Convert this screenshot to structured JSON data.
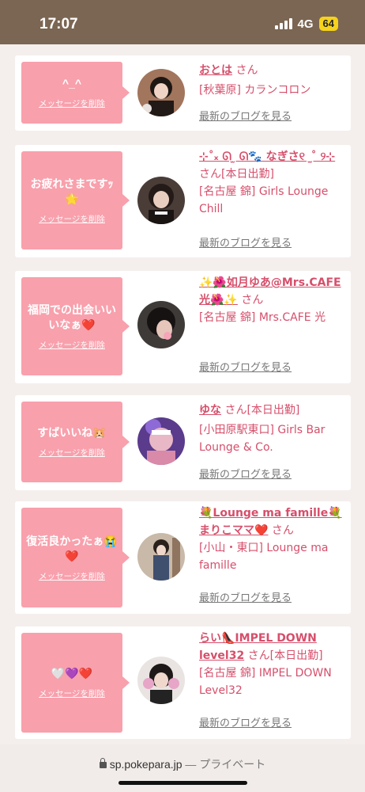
{
  "status_bar": {
    "time": "17:07",
    "network": "4G",
    "battery": "64"
  },
  "messages": [
    {
      "message": "^_^",
      "delete_label": "メッセージを削除",
      "name": "おとは",
      "san": "さん",
      "tag": "",
      "shop": "[秋葉原] カランコロン",
      "blog_label": "最新のブログを見る"
    },
    {
      "message": "お疲れさまですｯ🌟",
      "delete_label": "メッセージを削除",
      "name": "⊹˚ₓ ᘏ ̫ ᘏ🐾 なぎさ୧⁠ ⁠ ̫ ̊ ୨⊹",
      "san": "さん",
      "tag": "[本日出勤]",
      "shop": "[名古屋 錦] Girls Lounge Chill",
      "blog_label": "最新のブログを見る"
    },
    {
      "message": "福岡での出会いいいなぁ❤️",
      "delete_label": "メッセージを削除",
      "name": "✨🌺如月ゆあ@Mrs.CAFE光🌺✨",
      "san": "さん",
      "tag": "",
      "shop": "[名古屋 錦] Mrs.CAFE 光",
      "blog_label": "最新のブログを見る"
    },
    {
      "message": "すばいいね🐹",
      "delete_label": "メッセージを削除",
      "name": "ゆな",
      "san": "さん",
      "tag": "[本日出勤]",
      "shop": "[小田原駅東口] Girls Bar Lounge & Co.",
      "blog_label": "最新のブログを見る"
    },
    {
      "message": "復活良かったぁ😭❤️",
      "delete_label": "メッセージを削除",
      "name": "💐Lounge ma famille💐まりこママ❤️",
      "san": "さん",
      "tag": "",
      "shop": "[小山・東口] Lounge ma famille",
      "blog_label": "最新のブログを見る"
    },
    {
      "message": "🤍💜❤️",
      "delete_label": "メッセージを削除",
      "name": "らい👠IMPEL DOWN level32",
      "san": "さん",
      "tag": "[本日出勤]",
      "shop": "[名古屋 錦] IMPEL DOWN Level32",
      "blog_label": "最新のブログを見る"
    }
  ],
  "url_bar": {
    "domain": "sp.pokepara.jp",
    "separator": "—",
    "mode": "プライベート"
  },
  "colors": {
    "accent": "#d64f6b",
    "bubble": "#f8a0ac",
    "status_bar": "#7b6653",
    "background": "#f4efed"
  }
}
